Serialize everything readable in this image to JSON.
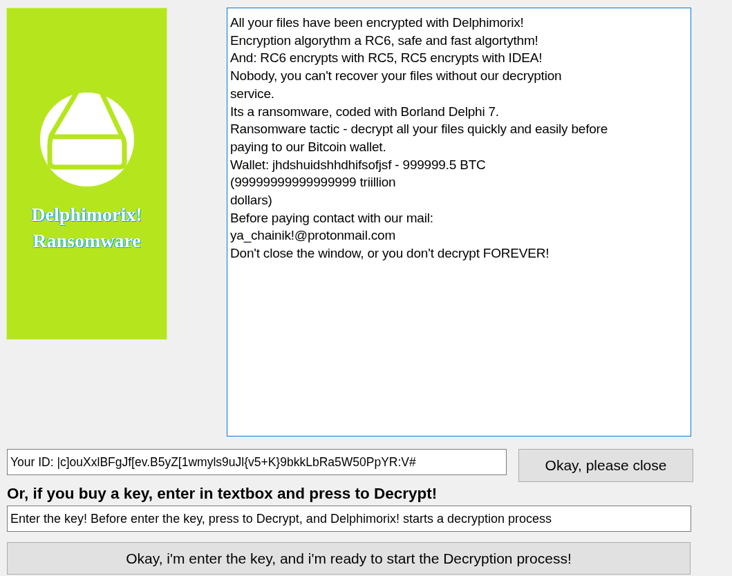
{
  "banner": {
    "title_lines": [
      "Delphimorix!",
      "Ransomware"
    ]
  },
  "message_lines": [
    "All your files have been encrypted with Delphimorix!",
    "Encryption algorythm a RC6, safe and fast algortythm!",
    "And: RC6 encrypts with RC5, RC5 encrypts with IDEA!",
    "Nobody, you can't recover your files without our decryption",
    "service.",
    "Its a ransomware, coded with Borland Delphi 7.",
    "Ransomware tactic - decrypt all your files quickly and easily before",
    "paying to our Bitcoin wallet.",
    "Wallet: jhdshuidshhdhifsofjsf - 999999.5 BTC",
    "(99999999999999999 triillion",
    "dollars)",
    "Before paying contact with our mail:",
    "ya_chainik!@protonmail.com",
    "Don't close the window, or you don't decrypt FOREVER!"
  ],
  "id_field": {
    "value": "Your ID: |c]ouXxlBFgJf[ev.B5yZ[1wmyls9uJl{v5+K}9bkkLbRa5W50PpYR:V#"
  },
  "close_button": "Okay, please close",
  "key_heading": "Or, if you buy a key, enter in textbox and press to Decrypt!",
  "key_field": {
    "value": "Enter the key! Before enter the key, press to Decrypt, and Delphimorix! starts a decryption process"
  },
  "decrypt_button": "Okay, i'm enter the key, and i'm ready to start the Decryption process!"
}
